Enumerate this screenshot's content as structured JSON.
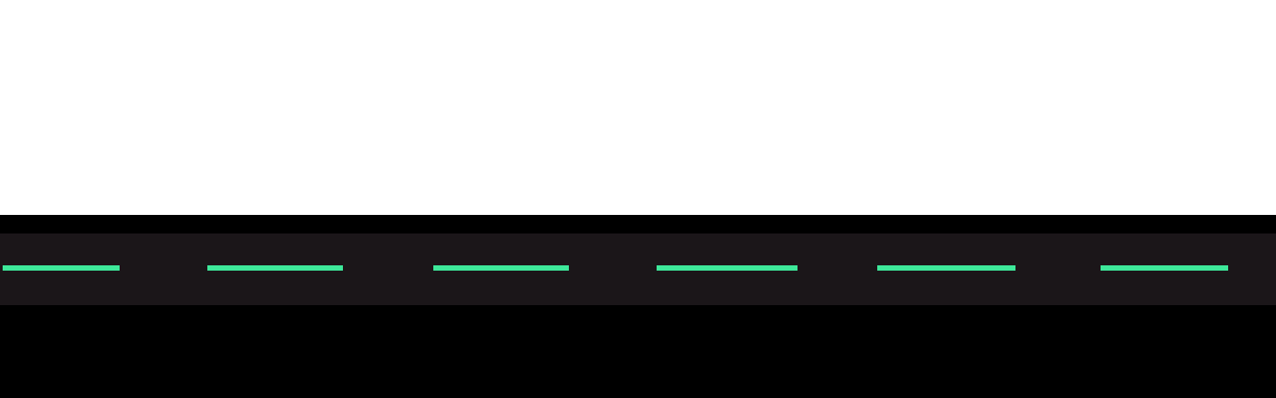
{
  "colors": {
    "top_background": "#ffffff",
    "bottom_background": "#000000",
    "strip_background": "#1b1619",
    "dash_accent": "#3ee89a"
  },
  "strip": {
    "indicator_count": 6
  }
}
